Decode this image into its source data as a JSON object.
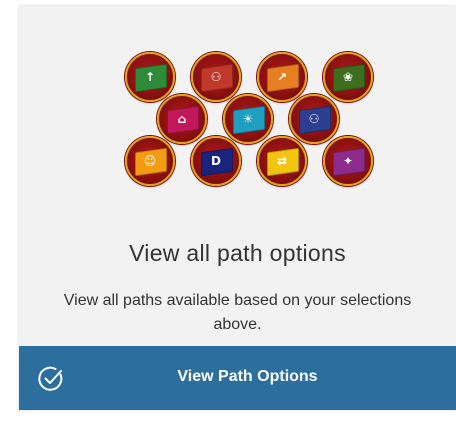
{
  "card": {
    "title": "View all path options",
    "description": "View all paths available based on your selections above.",
    "button_label": "View Path Options",
    "button_icon": "check-circle-icon",
    "accent_color": "#2c6f9e"
  },
  "badges": [
    {
      "icon": "microphone-icon",
      "color": "#2e8b3a",
      "glyph": "↑"
    },
    {
      "icon": "group-icon",
      "color": "#c0392b",
      "glyph": "⚇"
    },
    {
      "icon": "telescope-icon",
      "color": "#e67e22",
      "glyph": "↗"
    },
    {
      "icon": "crowd-icon",
      "color": "#3c6e1e",
      "glyph": "❀"
    },
    {
      "icon": "audience-icon",
      "color": "#c2185b",
      "glyph": "⌂"
    },
    {
      "icon": "lightbulb-icon",
      "color": "#1f9fbf",
      "glyph": "☀"
    },
    {
      "icon": "team-icon",
      "color": "#2c3e8f",
      "glyph": "⚇"
    },
    {
      "icon": "masks-icon",
      "color": "#f39c12",
      "glyph": "☺"
    },
    {
      "icon": "d-letter-icon",
      "color": "#1a237e",
      "glyph": "D"
    },
    {
      "icon": "arrows-icon",
      "color": "#f1c40f",
      "glyph": "⇄"
    },
    {
      "icon": "handshake-icon",
      "color": "#8e2c8e",
      "glyph": "✦"
    }
  ]
}
